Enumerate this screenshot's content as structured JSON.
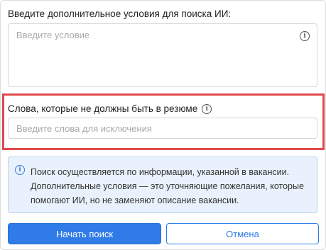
{
  "conditions": {
    "label": "Введите дополнительное условия для поиска ИИ:",
    "placeholder": "Введите условие",
    "info_icon": "info-icon"
  },
  "excluded_words": {
    "label": "Слова, которые не должны быть в резюме",
    "placeholder": "Введите слова для исключения",
    "info_icon": "info-icon",
    "highlight_color": "#e0494d"
  },
  "notice": {
    "icon": "info-icon",
    "lines": [
      "Поиск осуществляется по информации, указанной в вакансии.",
      "Дополнительные условия — это уточняющие пожелания, которые",
      "помогают ИИ, но не заменяют описание вакансии."
    ]
  },
  "actions": {
    "start_label": "Начать поиск",
    "cancel_label": "Отмена"
  },
  "colors": {
    "accent": "#2f7be7",
    "notice_bg": "#e8f1fc"
  }
}
